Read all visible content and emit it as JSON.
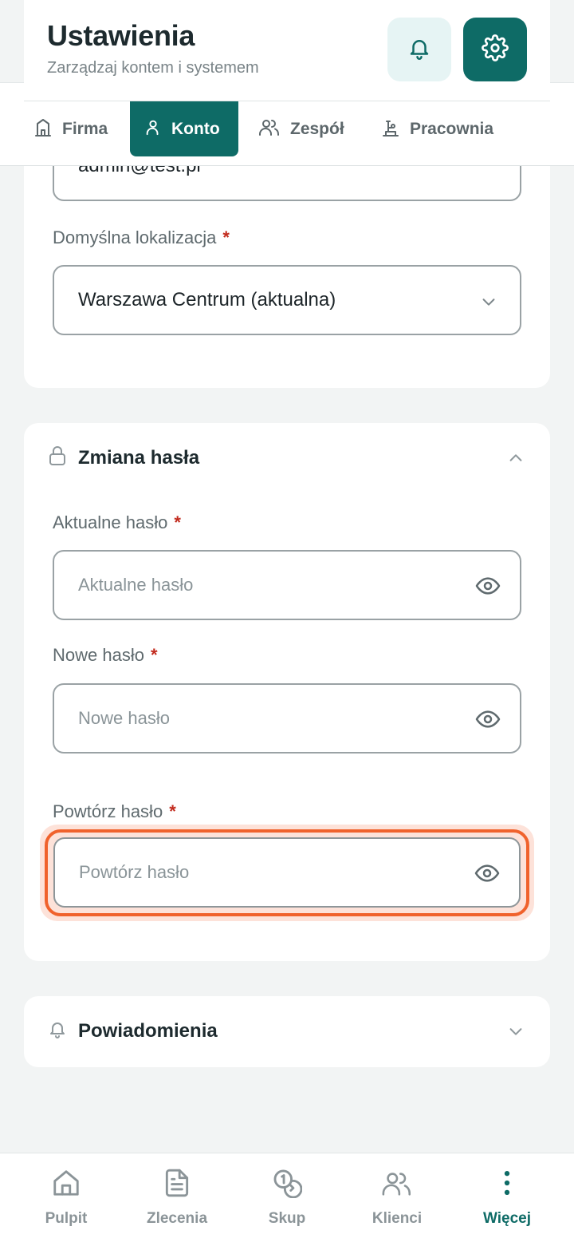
{
  "header": {
    "title": "Ustawienia",
    "subtitle": "Zarządzaj kontem i systemem",
    "bell_icon": "bell-icon",
    "gear_icon": "gear-icon"
  },
  "tabs": [
    {
      "label": "Firma",
      "icon": "building-icon",
      "active": false
    },
    {
      "label": "Konto",
      "icon": "user-icon",
      "active": true
    },
    {
      "label": "Zespół",
      "icon": "users-icon",
      "active": false
    },
    {
      "label": "Pracownia",
      "icon": "workshop-icon",
      "active": false
    }
  ],
  "account": {
    "email_value": "admin@test.pl",
    "location_label": "Domyślna lokalizacja",
    "location_value": "Warszawa Centrum (aktualna)"
  },
  "password_section": {
    "title": "Zmiana hasła",
    "current_label": "Aktualne hasło",
    "current_placeholder": "Aktualne hasło",
    "new_label": "Nowe hasło",
    "new_placeholder": "Nowe hasło",
    "repeat_label": "Powtórz hasło",
    "repeat_placeholder": "Powtórz hasło",
    "required_mark": "*"
  },
  "notifications_section": {
    "title": "Powiadomienia"
  },
  "bottom_nav": [
    {
      "label": "Pulpit",
      "icon": "home-icon",
      "active": false
    },
    {
      "label": "Zlecenia",
      "icon": "document-icon",
      "active": false
    },
    {
      "label": "Skup",
      "icon": "coins-icon",
      "active": false
    },
    {
      "label": "Klienci",
      "icon": "users-icon",
      "active": false
    },
    {
      "label": "Więcej",
      "icon": "more-vertical-icon",
      "active": true
    }
  ],
  "colors": {
    "primary": "#0e6b66",
    "focus": "#f0622c",
    "required": "#c22a1d",
    "background": "#f2f4f4"
  }
}
